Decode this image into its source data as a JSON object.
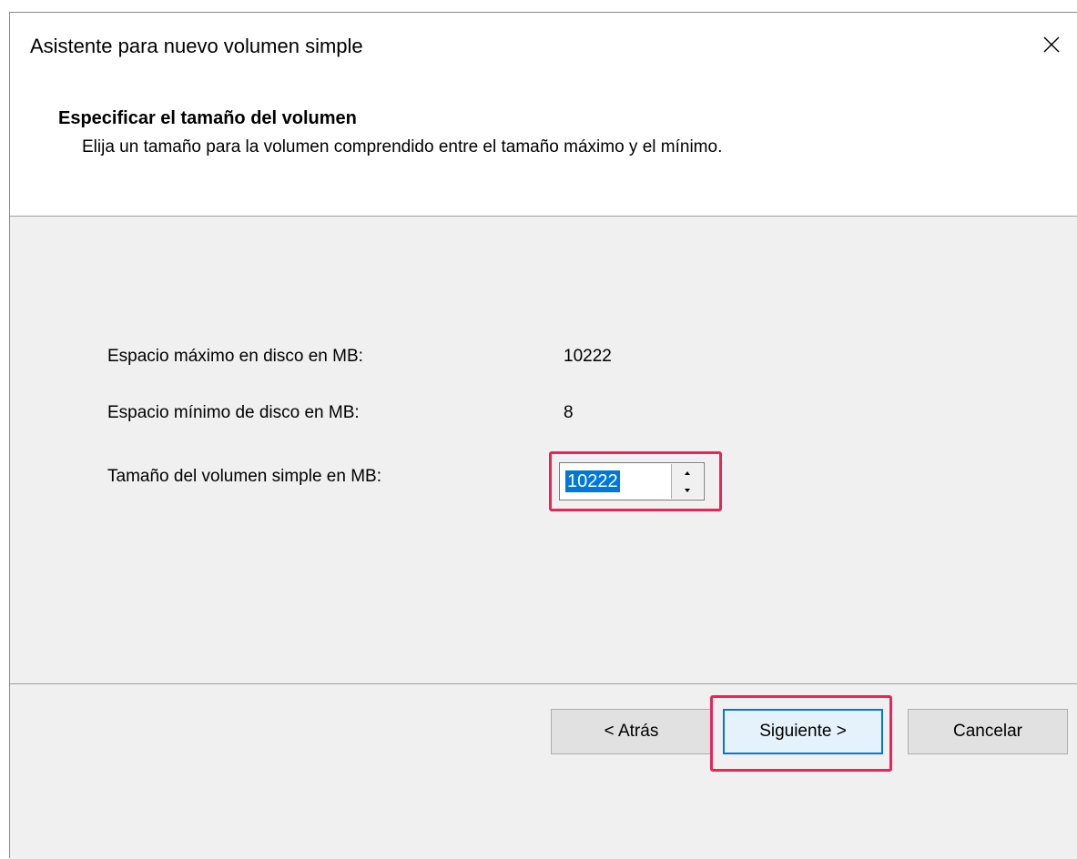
{
  "window": {
    "title": "Asistente para nuevo volumen simple",
    "close_symbol": "✕"
  },
  "header": {
    "title": "Especificar el tamaño del volumen",
    "description": "Elija un tamaño para la volumen comprendido entre el tamaño máximo y el mínimo."
  },
  "fields": {
    "max_space_label": "Espacio máximo en disco en MB:",
    "max_space_value": "10222",
    "min_space_label": "Espacio mínimo de disco en MB:",
    "min_space_value": "8",
    "size_label": "Tamaño del volumen simple en MB:",
    "size_value": "10222"
  },
  "buttons": {
    "back_label": "< Atrás",
    "next_label": "Siguiente >",
    "cancel_label": "Cancelar"
  },
  "colors": {
    "highlight": "#e8245a",
    "selection": "#0078d7"
  },
  "icons": {
    "close": "close-icon",
    "spin_up": "chevron-up-icon",
    "spin_down": "chevron-down-icon"
  }
}
